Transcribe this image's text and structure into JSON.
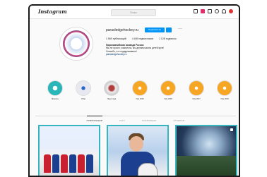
{
  "app": {
    "logo": "Instagram"
  },
  "search": {
    "placeholder": "Поиск"
  },
  "profile": {
    "username": "parasledgehockey.ru",
    "message_label": "Подписаться",
    "more": "···",
    "stats": {
      "posts": "1 569 публикаций",
      "followers": "4 469 подписчиков",
      "following": "1 128 подписок"
    },
    "bio": {
      "name": "Паралимпийская команда России",
      "line1": "Мы не просто хоккеисты, мы делаем жизнь детей ярче!",
      "line2": "Спасибо, что поддерживаете!",
      "link": "parasledgehockey.ru"
    }
  },
  "highlights": [
    {
      "label": "Проекты",
      "style": "teal"
    },
    {
      "label": "Сбор",
      "style": "rink"
    },
    {
      "label": "Люди года",
      "style": "ppl"
    },
    {
      "label": "Чем 2019",
      "style": "gold"
    },
    {
      "label": "Чем 2018",
      "style": "gold"
    },
    {
      "label": "Чем 2017",
      "style": "gold"
    },
    {
      "label": "Чем 2016",
      "style": "gold"
    }
  ],
  "tabs": [
    {
      "label": "ПУБЛИКАЦИИ",
      "active": true
    },
    {
      "label": "IGTV",
      "active": false
    },
    {
      "label": "СОХРАНЕНО",
      "active": false
    },
    {
      "label": "ОТМЕТКИ",
      "active": false
    }
  ],
  "colors": {
    "accent": "#0095f6",
    "post_border": "#38b6c0",
    "highlight_gold": "#f6a623"
  }
}
